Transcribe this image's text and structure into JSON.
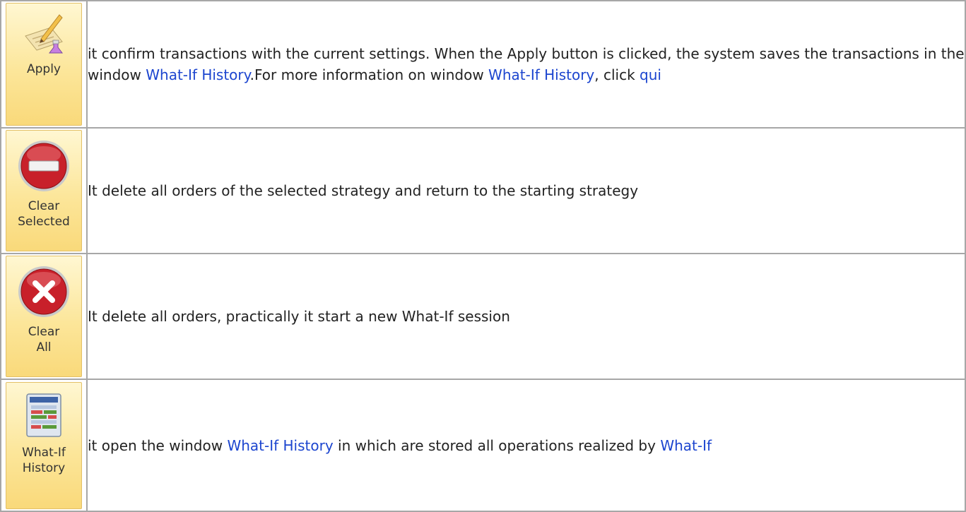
{
  "rows": [
    {
      "button_label_lines": [
        "Apply"
      ],
      "icon": "apply-icon",
      "description": {
        "part1": "it confirm transactions with the current settings. When the Apply button is clicked, the system saves the transactions in the window ",
        "link1": "What-If History",
        "part2": ".For more information on window ",
        "link2": "What-If History",
        "part3": ", click ",
        "link3": "qui"
      }
    },
    {
      "button_label_lines": [
        "Clear",
        "Selected"
      ],
      "icon": "no-entry-icon",
      "description": {
        "text": "It delete all orders of the selected strategy and return to the starting strategy"
      }
    },
    {
      "button_label_lines": [
        "Clear",
        "All"
      ],
      "icon": "x-circle-icon",
      "description": {
        "text": "It delete all orders, practically it start a new What-If session"
      }
    },
    {
      "button_label_lines": [
        "What-If",
        "History"
      ],
      "icon": "history-window-icon",
      "description": {
        "part1": "it open the window ",
        "link1": "What-If History",
        "part2": " in which are stored all operations realized by ",
        "link2": "What-If"
      }
    }
  ],
  "colors": {
    "link": "#1c45cf",
    "border": "#a7a7a7",
    "button_bg": "#fce69a"
  }
}
